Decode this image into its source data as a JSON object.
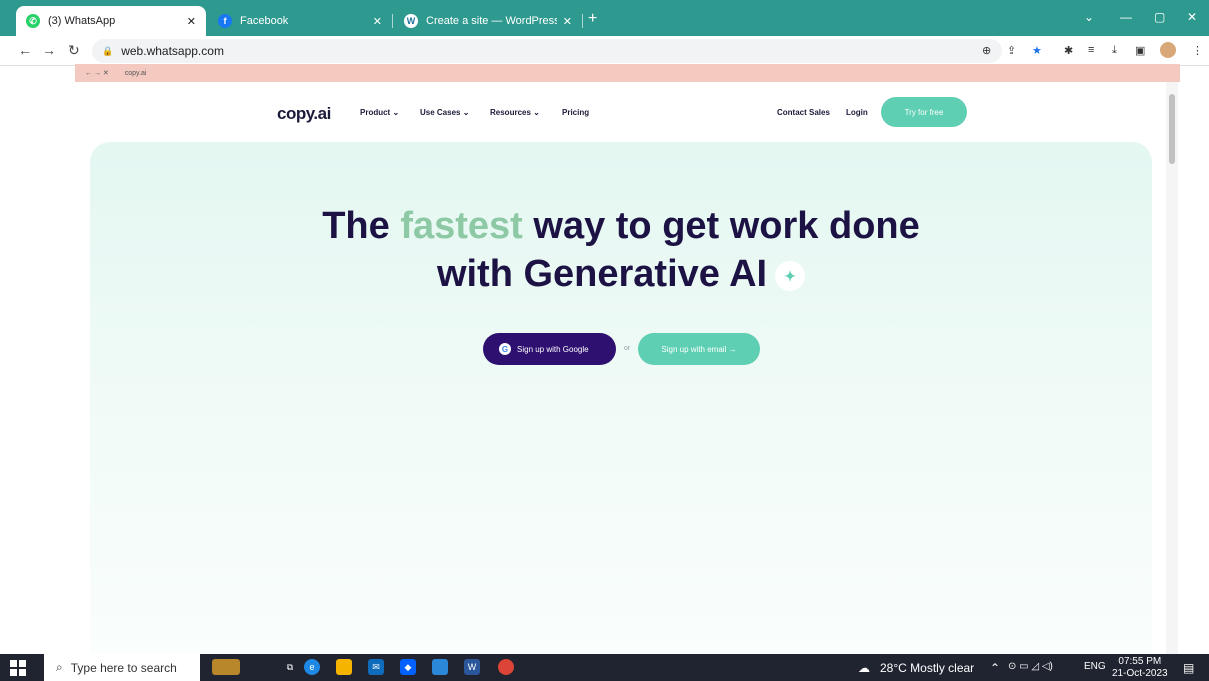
{
  "browser": {
    "tabs": [
      {
        "title": "(3) WhatsApp",
        "active": true
      },
      {
        "title": "Facebook",
        "active": false
      },
      {
        "title": "Create a site — WordPress.com",
        "active": false
      }
    ],
    "new_tab_icon": "plus-icon",
    "address": "web.whatsapp.com",
    "inner_address": "copy.ai",
    "colors": {
      "tab_strip": "#2e9a8f"
    }
  },
  "site": {
    "logo": "copy.ai",
    "nav": {
      "product": "Product",
      "use_cases": "Use Cases",
      "resources": "Resources",
      "pricing": "Pricing",
      "contact_sales": "Contact Sales",
      "login": "Login",
      "try_free": "Try for free"
    },
    "hero": {
      "headline_part1": "The ",
      "headline_accent": "fastest",
      "headline_part2": " way to get work done",
      "headline_line2": "with Generative AI",
      "google_button": "Sign up with Google",
      "or": "or",
      "email_button": "Sign up with email →"
    },
    "colors": {
      "primary": "#2e1070",
      "accent": "#5ecfb2",
      "text": "#1c1243",
      "highlight": "#8ec9a6"
    }
  },
  "taskbar": {
    "search_placeholder": "Type here to search",
    "weather": "28°C  Mostly clear",
    "language": "ENG",
    "time": "07:55 PM",
    "date": "21-Oct-2023"
  }
}
